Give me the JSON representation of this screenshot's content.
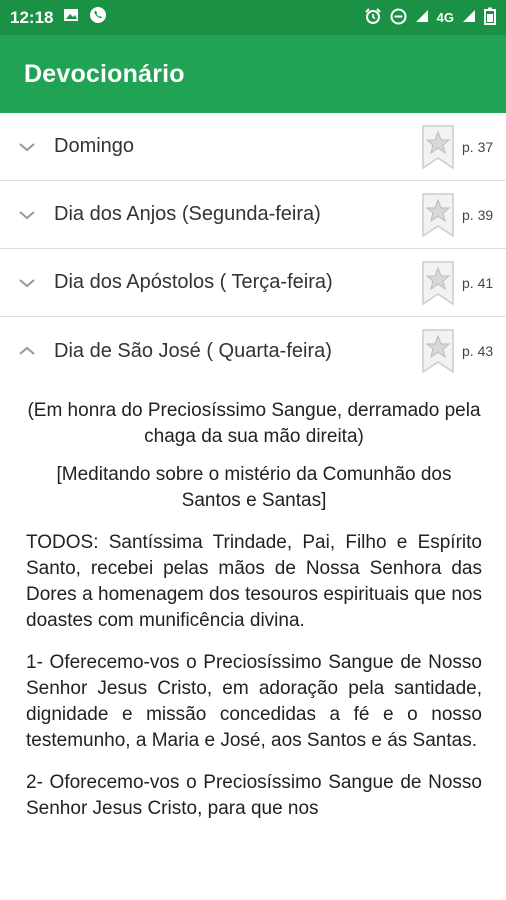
{
  "status_bar": {
    "time": "12:18",
    "network": "4G"
  },
  "app_bar": {
    "title": "Devocionário"
  },
  "items": [
    {
      "label": "Domingo",
      "page": "p. 37",
      "expanded": false
    },
    {
      "label": "Dia dos Anjos (Segunda-feira)",
      "page": "p. 39",
      "expanded": false
    },
    {
      "label": "Dia dos Apóstolos ( Terça-feira)",
      "page": "p. 41",
      "expanded": false
    },
    {
      "label": "Dia de São José ( Quarta-feira)",
      "page": "p. 43",
      "expanded": true
    }
  ],
  "content": {
    "intro1": "(Em honra do Preciosíssimo Sangue, derramado pela chaga da sua mão direita)",
    "intro2": "[Meditando sobre o mistério da Comunhão dos Santos e Santas]",
    "para1": "TODOS: Santíssima Trindade, Pai, Filho e Espírito Santo, recebei pelas mãos de Nossa Senhora das Dores a homenagem dos tesouros espirituais que nos doastes com munificência divina.",
    "para2": "1- Oferecemo-vos o Preciosíssimo Sangue de Nosso Senhor Jesus Cristo, em adoração pela santidade, dignidade e missão concedidas a fé e o nosso testemunho, a Maria e José, aos Santos e ás Santas.",
    "para3": "2- Oforecemo-vos o Preciosíssimo Sangue de Nosso Senhor Jesus Cristo, para que nos"
  },
  "colors": {
    "status_bar": "#1a9145",
    "app_bar": "#21a356"
  }
}
